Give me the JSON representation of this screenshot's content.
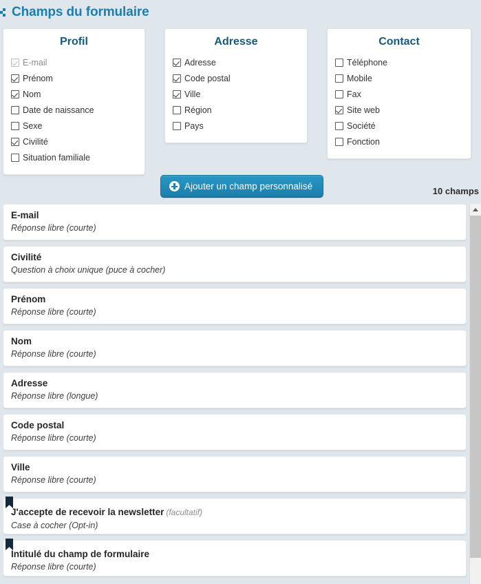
{
  "header": {
    "title": "Champs du formulaire",
    "icon": "chevron-right-icon",
    "accent_color": "#1a7fad"
  },
  "panels": [
    {
      "id": "profil",
      "title": "Profil",
      "options": [
        {
          "label": "E-mail",
          "checked": true,
          "disabled": true
        },
        {
          "label": "Prénom",
          "checked": true,
          "disabled": false
        },
        {
          "label": "Nom",
          "checked": true,
          "disabled": false
        },
        {
          "label": "Date de naissance",
          "checked": false,
          "disabled": false
        },
        {
          "label": "Sexe",
          "checked": false,
          "disabled": false
        },
        {
          "label": "Civilité",
          "checked": true,
          "disabled": false
        },
        {
          "label": "Situation familiale",
          "checked": false,
          "disabled": false
        }
      ]
    },
    {
      "id": "adresse",
      "title": "Adresse",
      "options": [
        {
          "label": "Adresse",
          "checked": true,
          "disabled": false
        },
        {
          "label": "Code postal",
          "checked": true,
          "disabled": false
        },
        {
          "label": "Ville",
          "checked": true,
          "disabled": false
        },
        {
          "label": "Région",
          "checked": false,
          "disabled": false
        },
        {
          "label": "Pays",
          "checked": false,
          "disabled": false
        }
      ]
    },
    {
      "id": "contact",
      "title": "Contact",
      "options": [
        {
          "label": "Téléphone",
          "checked": false,
          "disabled": false
        },
        {
          "label": "Mobile",
          "checked": false,
          "disabled": false
        },
        {
          "label": "Fax",
          "checked": false,
          "disabled": false
        },
        {
          "label": "Site web",
          "checked": true,
          "disabled": false
        },
        {
          "label": "Société",
          "checked": false,
          "disabled": false
        },
        {
          "label": "Fonction",
          "checked": false,
          "disabled": false
        }
      ]
    }
  ],
  "action_bar": {
    "add_field_label": "Ajouter un champ personnalisé",
    "add_field_icon": "plus-circle-icon",
    "field_count_label": "10 champs",
    "button_color": "#1b7fad"
  },
  "fields": [
    {
      "title": "E-mail",
      "optional": "",
      "type": "Réponse libre (courte)",
      "flagged": false
    },
    {
      "title": "Civilité",
      "optional": "",
      "type": "Question à choix unique (puce à cocher)",
      "flagged": false
    },
    {
      "title": "Prénom",
      "optional": "",
      "type": "Réponse libre (courte)",
      "flagged": false
    },
    {
      "title": "Nom",
      "optional": "",
      "type": "Réponse libre (courte)",
      "flagged": false
    },
    {
      "title": "Adresse",
      "optional": "",
      "type": "Réponse libre (longue)",
      "flagged": false
    },
    {
      "title": "Code postal",
      "optional": "",
      "type": "Réponse libre (courte)",
      "flagged": false
    },
    {
      "title": "Ville",
      "optional": "",
      "type": "Réponse libre (courte)",
      "flagged": false
    },
    {
      "title": "J'accepte de recevoir la newsletter",
      "optional": "(facultatif)",
      "type": "Case à cocher (Opt-in)",
      "flagged": true
    },
    {
      "title": "Intitulé du champ de formulaire",
      "optional": "",
      "type": "Réponse libre (courte)",
      "flagged": true
    }
  ],
  "scrollbar": {
    "up_icon": "scroll-up-arrow-icon"
  }
}
